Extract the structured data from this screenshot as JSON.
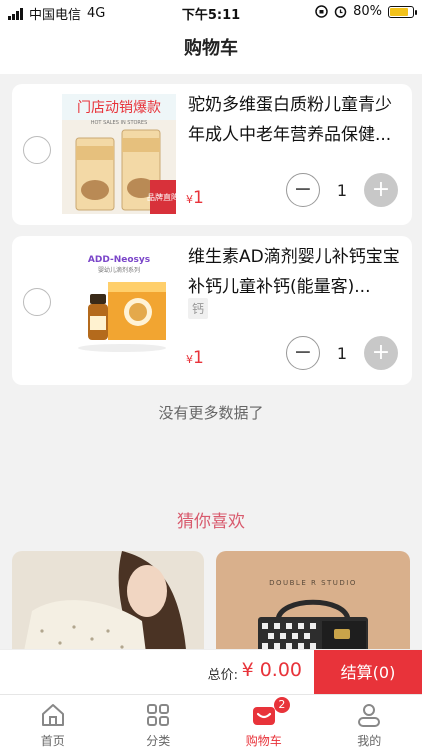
{
  "status_bar": {
    "carrier": "中国电信",
    "network": "4G",
    "time": "下午5:11",
    "battery": "80%",
    "battery_level": 0.8
  },
  "header": {
    "title": "购物车"
  },
  "cart": {
    "items": [
      {
        "title": "驼奶多维蛋白质粉儿童青少年成人中老年营养品保健...",
        "image_banner": "门店动销爆款",
        "image_subtitle": "HOT SALES IN STORES",
        "image_badge": "品牌直降",
        "price_symbol": "¥",
        "price": "1",
        "quantity": "1"
      },
      {
        "title": "维生素AD滴剂婴儿补钙宝宝补钙儿童补钙(能量客)...",
        "spec": "钙",
        "image_brand": "ADD-Neosys",
        "image_subtitle": "婴幼儿滴剂系列",
        "price_symbol": "¥",
        "price": "1",
        "quantity": "1"
      }
    ],
    "minus_label": "−",
    "plus_label": "+",
    "no_more_text": "没有更多数据了"
  },
  "recommend": {
    "title": "猜你喜欢",
    "card2_text": "DOUBLE R STUDIO"
  },
  "checkout": {
    "total_label": "总价:",
    "total_value": "¥ 0.00",
    "button_label": "结算(0)"
  },
  "tab_bar": {
    "tabs": [
      {
        "label": "首页",
        "icon": "home-icon"
      },
      {
        "label": "分类",
        "icon": "grid-icon"
      },
      {
        "label": "购物车",
        "icon": "cart-icon",
        "badge": "2"
      },
      {
        "label": "我的",
        "icon": "user-icon"
      }
    ]
  },
  "colors": {
    "accent": "#e8333a",
    "recommend_title": "#d85a6d",
    "background": "#f2f2f2"
  }
}
